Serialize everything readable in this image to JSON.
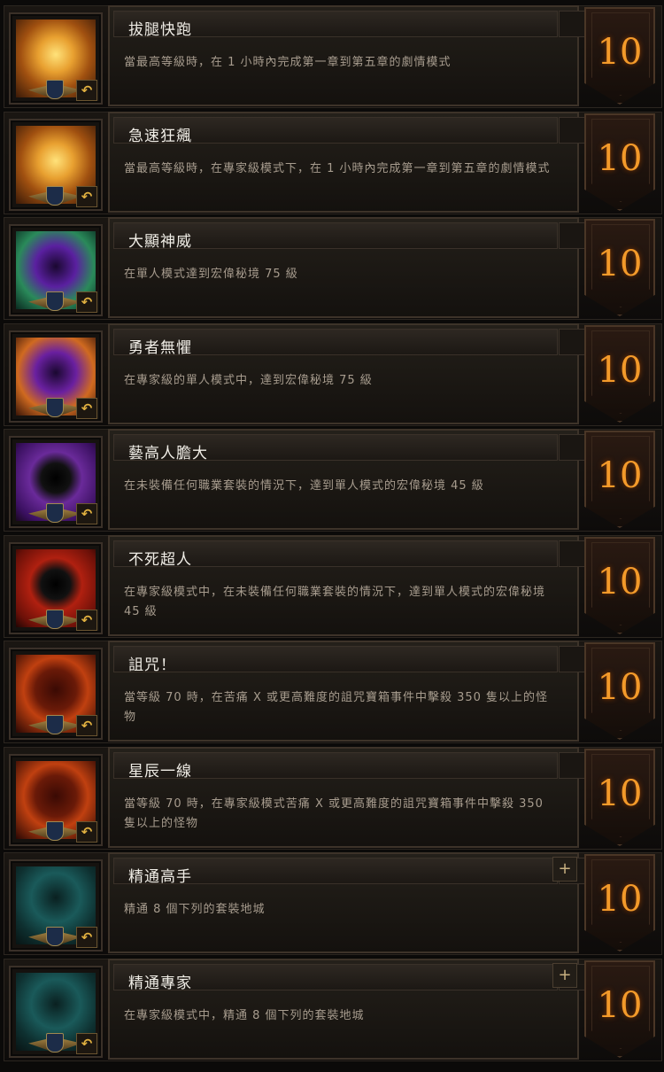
{
  "achievements": [
    {
      "title": "拔腿快跑",
      "desc": "當最高等級時，在 1 小時內完成第一章到第五章的劇情模式",
      "points": "10",
      "icon_name": "clock-gold-icon",
      "art": "clock"
    },
    {
      "title": "急速狂飆",
      "desc": "當最高等級時，在專家級模式下，在 1 小時內完成第一章到第五章的劇情模式",
      "points": "10",
      "icon_name": "clock-gold-icon",
      "art": "clock"
    },
    {
      "title": "大顯神威",
      "desc": "在單人模式達到宏偉秘境 75 級",
      "points": "10",
      "icon_name": "portal-purple-icon",
      "art": "portal-green"
    },
    {
      "title": "勇者無懼",
      "desc": "在專家級的單人模式中，達到宏偉秘境 75 級",
      "points": "10",
      "icon_name": "portal-purple-icon",
      "art": "portal-orange"
    },
    {
      "title": "藝高人膽大",
      "desc": "在未裝備任何職業套裝的情況下，達到單人模式的宏偉秘境 45 級",
      "points": "10",
      "icon_name": "locked-slot-icon",
      "art": "slot-purple"
    },
    {
      "title": "不死超人",
      "desc": "在專家級模式中，在未裝備任何職業套裝的情況下，達到單人模式的宏偉秘境 45 級",
      "points": "10",
      "icon_name": "locked-slot-icon",
      "art": "slot-red"
    },
    {
      "title": "詛咒！",
      "desc": "當等級 70 時，在苦痛 X 或更高難度的詛咒寶箱事件中擊殺 350 隻以上的怪物",
      "points": "10",
      "icon_name": "cursed-chest-icon",
      "art": "chest"
    },
    {
      "title": "星辰一線",
      "desc": "當等級 70 時，在專家級模式苦痛 X 或更高難度的詛咒寶箱事件中擊殺 350 隻以上的怪物",
      "points": "10",
      "icon_name": "cursed-chest-icon",
      "art": "chest"
    },
    {
      "title": "精通高手",
      "desc": "精通 8 個下列的套裝地城",
      "points": "10",
      "icon_name": "dungeon-pillar-icon",
      "art": "pillar",
      "expand": "+"
    },
    {
      "title": "精通專家",
      "desc": "在專家級模式中，精通 8 個下列的套裝地城",
      "points": "10",
      "icon_name": "dungeon-pillar-icon",
      "art": "pillar",
      "expand": "+"
    }
  ],
  "undo_glyph": "↶",
  "colors": {
    "points": "#f39a2a",
    "title": "#f0ede6",
    "desc": "#a79c8e"
  }
}
